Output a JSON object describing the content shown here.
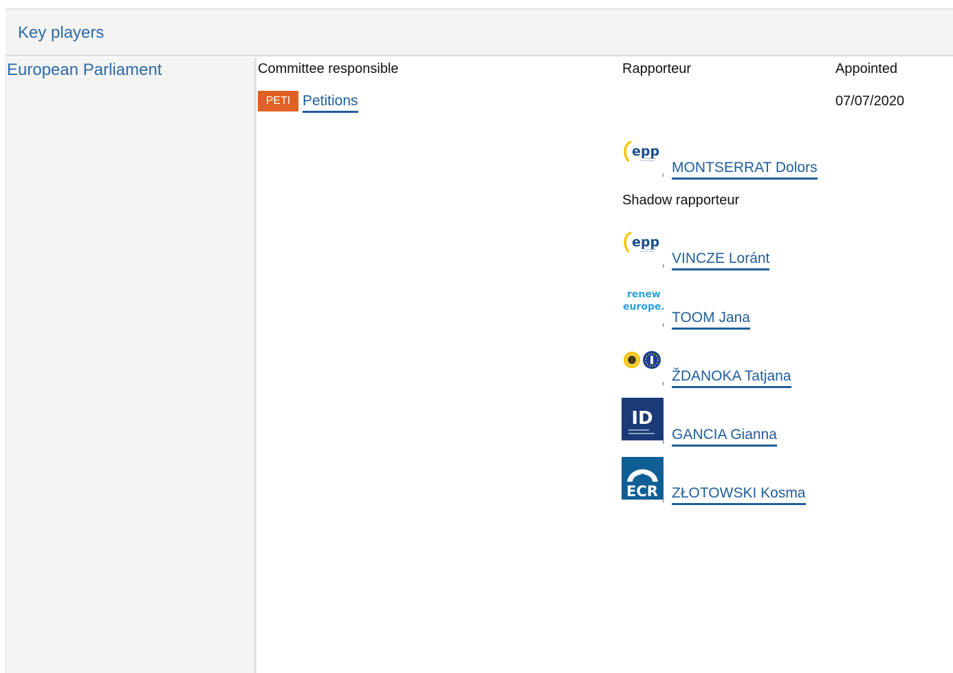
{
  "header": {
    "title": "Key players"
  },
  "institution": {
    "name": "European Parliament"
  },
  "columns": {
    "committee": "Committee responsible",
    "rapporteur": "Rapporteur",
    "appointed": "Appointed"
  },
  "committee": {
    "code": "PETI",
    "name": "Petitions",
    "appointed": "07/07/2020"
  },
  "rapporteur": {
    "name": "MONTSERRAT Dolors",
    "group_logo": "epp-logo"
  },
  "shadow": {
    "label": "Shadow rapporteur",
    "items": [
      {
        "name": "VINCZE Loránt",
        "group_logo": "epp-logo"
      },
      {
        "name": "TOOM Jana",
        "group_logo": "renew-europe-logo"
      },
      {
        "name": "ŽDANOKA Tatjana",
        "group_logo": "greens-efa-logo"
      },
      {
        "name": "GANCIA Gianna",
        "group_logo": "id-logo"
      },
      {
        "name": "ZŁOTOWSKI Kosma",
        "group_logo": "ecr-logo"
      }
    ]
  },
  "logos": {
    "epp": "epp",
    "renew": [
      "renew",
      "europe."
    ],
    "id": "ID",
    "ecr": "ECR"
  },
  "colors": {
    "link": "#1f5d9a",
    "header_text": "#2c6ba8",
    "badge": "#e06025",
    "panel": "#f4f4f4"
  }
}
